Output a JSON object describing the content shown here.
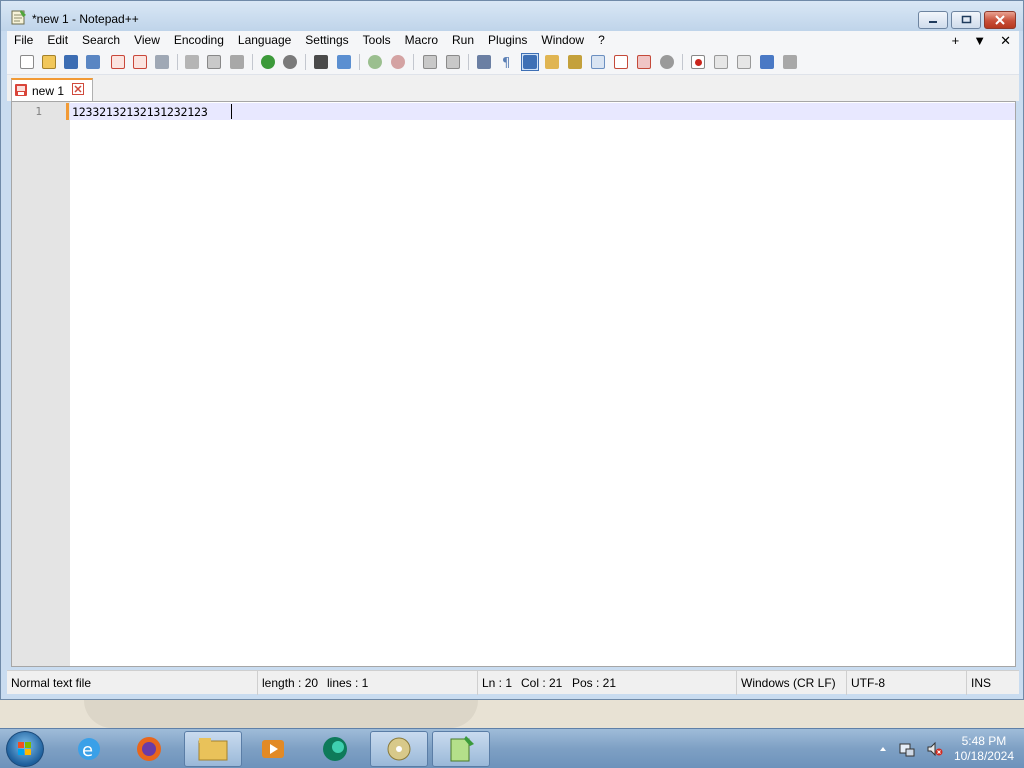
{
  "window": {
    "title": "*new 1 - Notepad++"
  },
  "menu": {
    "items": [
      "File",
      "Edit",
      "Search",
      "View",
      "Encoding",
      "Language",
      "Settings",
      "Tools",
      "Macro",
      "Run",
      "Plugins",
      "Window",
      "?"
    ],
    "right": [
      "+",
      "▼",
      "✕"
    ]
  },
  "toolbar": {
    "buttons": [
      "new-file",
      "open-file",
      "save",
      "save-all",
      "close",
      "close-all",
      "print",
      "cut",
      "copy",
      "paste",
      "undo",
      "redo",
      "find",
      "replace",
      "zoom-in",
      "zoom-out",
      "sync-vertical",
      "sync-horizontal",
      "word-wrap",
      "show-all-characters",
      "indent-guide",
      "user-defined-language",
      "document-map",
      "function-list",
      "folder-as-workspace",
      "monitoring",
      "record-macro",
      "stop-recording",
      "playback-macro",
      "run-macro-multiple",
      "save-macro"
    ]
  },
  "tab": {
    "label": "new 1"
  },
  "editor": {
    "line_number": "1",
    "line_text": "12332132132131232123"
  },
  "status": {
    "file_type": "Normal text file",
    "length": "length : 20",
    "lines": "lines : 1",
    "ln": "Ln : 1",
    "col": "Col : 21",
    "pos": "Pos : 21",
    "eol": "Windows (CR LF)",
    "encoding": "UTF-8",
    "mode": "INS"
  },
  "taskbar": {
    "apps": [
      "internet-explorer",
      "firefox",
      "file-explorer",
      "media-player",
      "app-green",
      "disc-app",
      "notepad-plus-plus"
    ],
    "time": "5:48 PM",
    "date": "10/18/2024"
  },
  "colors": {
    "accent_tab": "#f29a35",
    "current_line": "#e8e8ff",
    "gutter": "#e4e4e4"
  }
}
